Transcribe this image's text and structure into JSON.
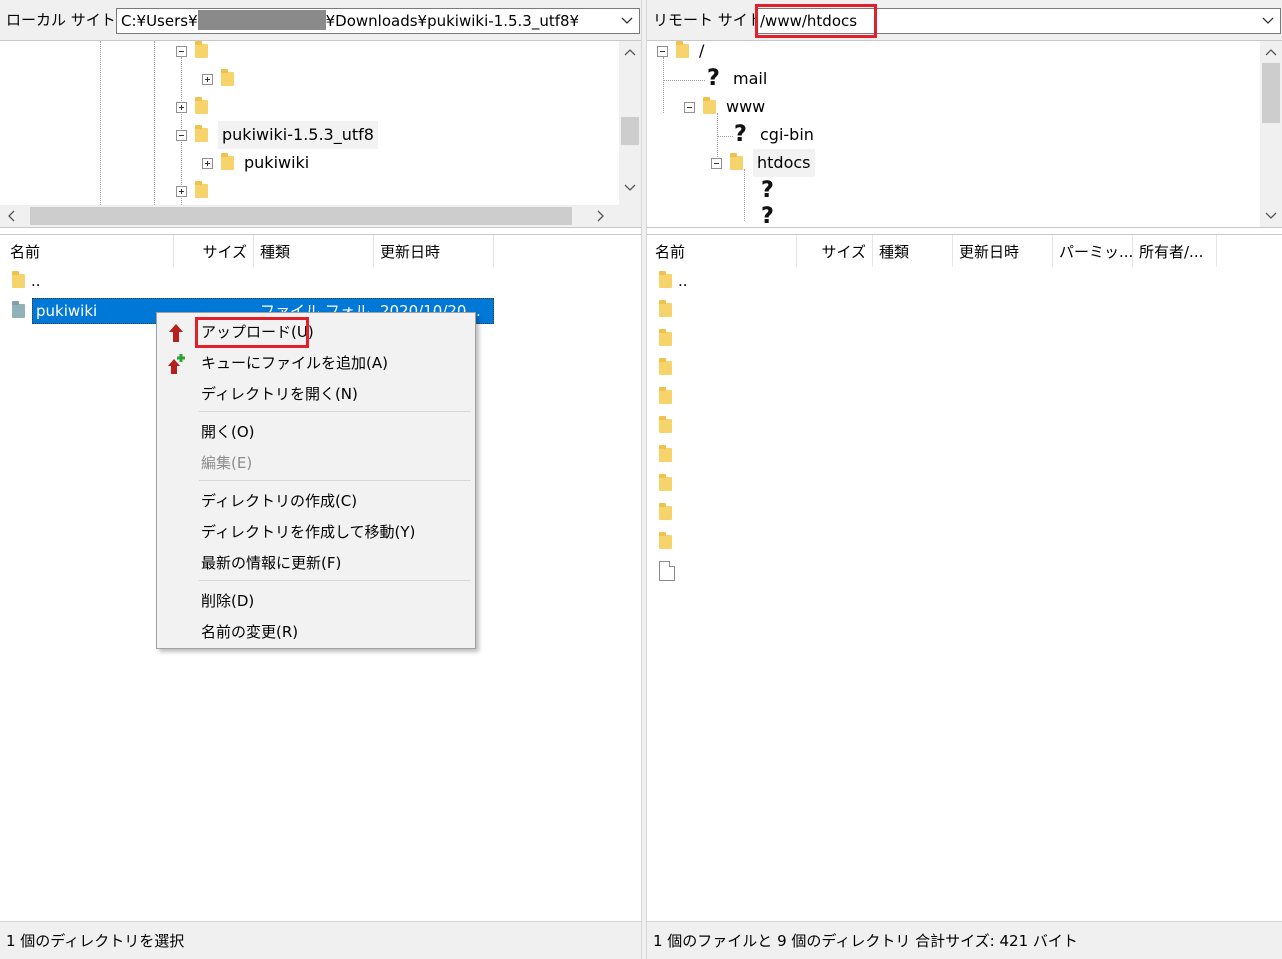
{
  "left": {
    "site_label": "ローカル サイト:",
    "path_prefix": "C:¥Users¥",
    "path_suffix": "¥Downloads¥pukiwiki-1.5.3_utf8¥",
    "tree": {
      "folder_pukiwiki_153": "pukiwiki-1.5.3_utf8",
      "folder_pukiwiki": "pukiwiki"
    },
    "columns": [
      "名前",
      "サイズ",
      "種類",
      "更新日時"
    ],
    "rows": [
      {
        "name": "..",
        "size": "",
        "type": "",
        "modified": ""
      },
      {
        "name": "pukiwiki",
        "size": "",
        "type": "ファイル フォル...",
        "modified": "2020/10/20..."
      }
    ],
    "status": "1 個のディレクトリを選択"
  },
  "right": {
    "site_label": "リモート サイト:",
    "path": "/www/htdocs",
    "tree": {
      "root": "/",
      "mail": "mail",
      "www": "www",
      "cgi_bin": "cgi-bin",
      "htdocs": "htdocs"
    },
    "columns": [
      "名前",
      "サイズ",
      "種類",
      "更新日時",
      "パーミッ...",
      "所有者/..."
    ],
    "rows": [
      {
        "name": ".."
      }
    ],
    "status": "1 個のファイルと 9 個のディレクトリ 合計サイズ: 421 バイト"
  },
  "context_menu": {
    "items": [
      {
        "label": "アップロード(U)",
        "icon": "upload-arrow-icon"
      },
      {
        "label": "キューにファイルを追加(A)",
        "icon": "add-to-queue-icon"
      },
      {
        "label": "ディレクトリを開く(N)"
      },
      {
        "label": "開く(O)"
      },
      {
        "label": "編集(E)",
        "disabled": true
      },
      {
        "label": "ディレクトリの作成(C)"
      },
      {
        "label": "ディレクトリを作成して移動(Y)"
      },
      {
        "label": "最新の情報に更新(F)"
      },
      {
        "label": "削除(D)"
      },
      {
        "label": "名前の変更(R)"
      }
    ]
  },
  "colors": {
    "selection": "#0078d7",
    "highlight_box": "#e0202a",
    "folder": "#f7d36b"
  }
}
